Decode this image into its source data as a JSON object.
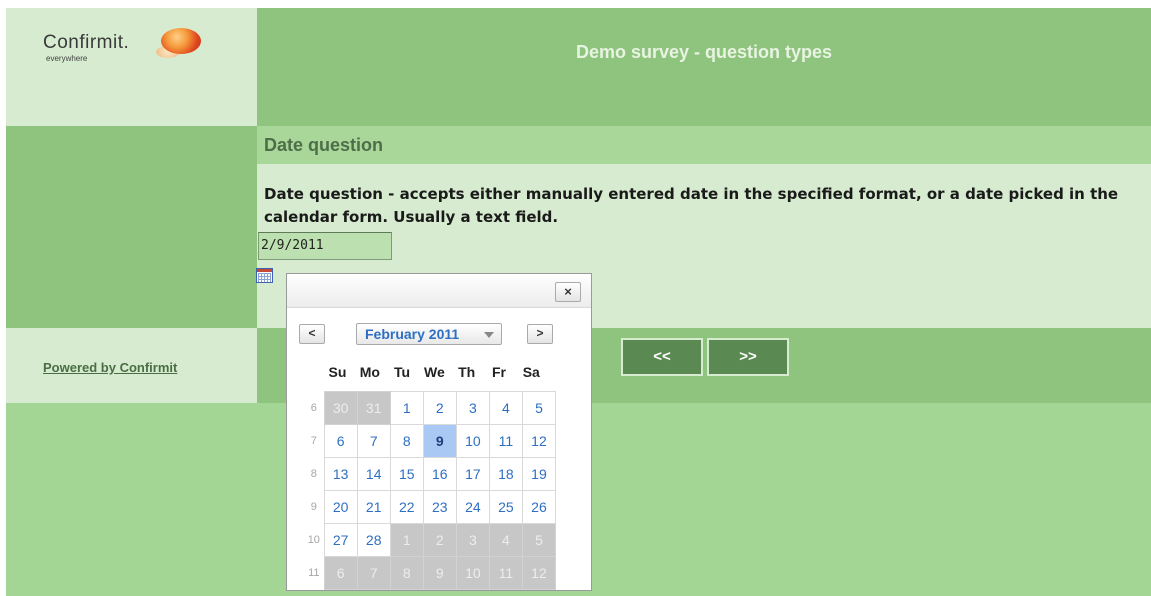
{
  "brand": {
    "name": "Confirmit.",
    "tagline": "everywhere"
  },
  "survey": {
    "title": "Demo survey - question types"
  },
  "question": {
    "title": "Date question",
    "text": "Date question - accepts either manually entered date in the specified format, or a date picked in the calendar form. Usually a text field.",
    "value": "2/9/2011"
  },
  "footer": {
    "powered_by": "Powered by Confirmit"
  },
  "nav": {
    "back_label": "<<",
    "forward_label": ">>"
  },
  "calendar": {
    "close_label": "×",
    "prev_label": "<",
    "next_label": ">",
    "month_label": "February 2011",
    "weekdays": [
      "Su",
      "Mo",
      "Tu",
      "We",
      "Th",
      "Fr",
      "Sa"
    ],
    "selected_day": "9",
    "weeks": [
      {
        "week": "6",
        "days": [
          {
            "d": "30",
            "other": true
          },
          {
            "d": "31",
            "other": true
          },
          {
            "d": "1"
          },
          {
            "d": "2"
          },
          {
            "d": "3"
          },
          {
            "d": "4"
          },
          {
            "d": "5"
          }
        ]
      },
      {
        "week": "7",
        "days": [
          {
            "d": "6"
          },
          {
            "d": "7"
          },
          {
            "d": "8"
          },
          {
            "d": "9",
            "selected": true
          },
          {
            "d": "10"
          },
          {
            "d": "11"
          },
          {
            "d": "12"
          }
        ]
      },
      {
        "week": "8",
        "days": [
          {
            "d": "13"
          },
          {
            "d": "14"
          },
          {
            "d": "15"
          },
          {
            "d": "16"
          },
          {
            "d": "17"
          },
          {
            "d": "18"
          },
          {
            "d": "19"
          }
        ]
      },
      {
        "week": "9",
        "days": [
          {
            "d": "20"
          },
          {
            "d": "21"
          },
          {
            "d": "22"
          },
          {
            "d": "23"
          },
          {
            "d": "24"
          },
          {
            "d": "25"
          },
          {
            "d": "26"
          }
        ]
      },
      {
        "week": "10",
        "days": [
          {
            "d": "27"
          },
          {
            "d": "28"
          },
          {
            "d": "1",
            "other": true
          },
          {
            "d": "2",
            "other": true
          },
          {
            "d": "3",
            "other": true
          },
          {
            "d": "4",
            "other": true
          },
          {
            "d": "5",
            "other": true
          }
        ]
      },
      {
        "week": "11",
        "days": [
          {
            "d": "6",
            "other": true
          },
          {
            "d": "7",
            "other": true
          },
          {
            "d": "8",
            "other": true
          },
          {
            "d": "9",
            "other": true
          },
          {
            "d": "10",
            "other": true
          },
          {
            "d": "11",
            "other": true
          },
          {
            "d": "12",
            "other": true
          }
        ]
      }
    ]
  },
  "colors": {
    "header": "#8ec47e",
    "background": "#a3d695",
    "light": "#d6ebcf",
    "accent": "#2e6fc3",
    "button": "#5a8a51"
  }
}
